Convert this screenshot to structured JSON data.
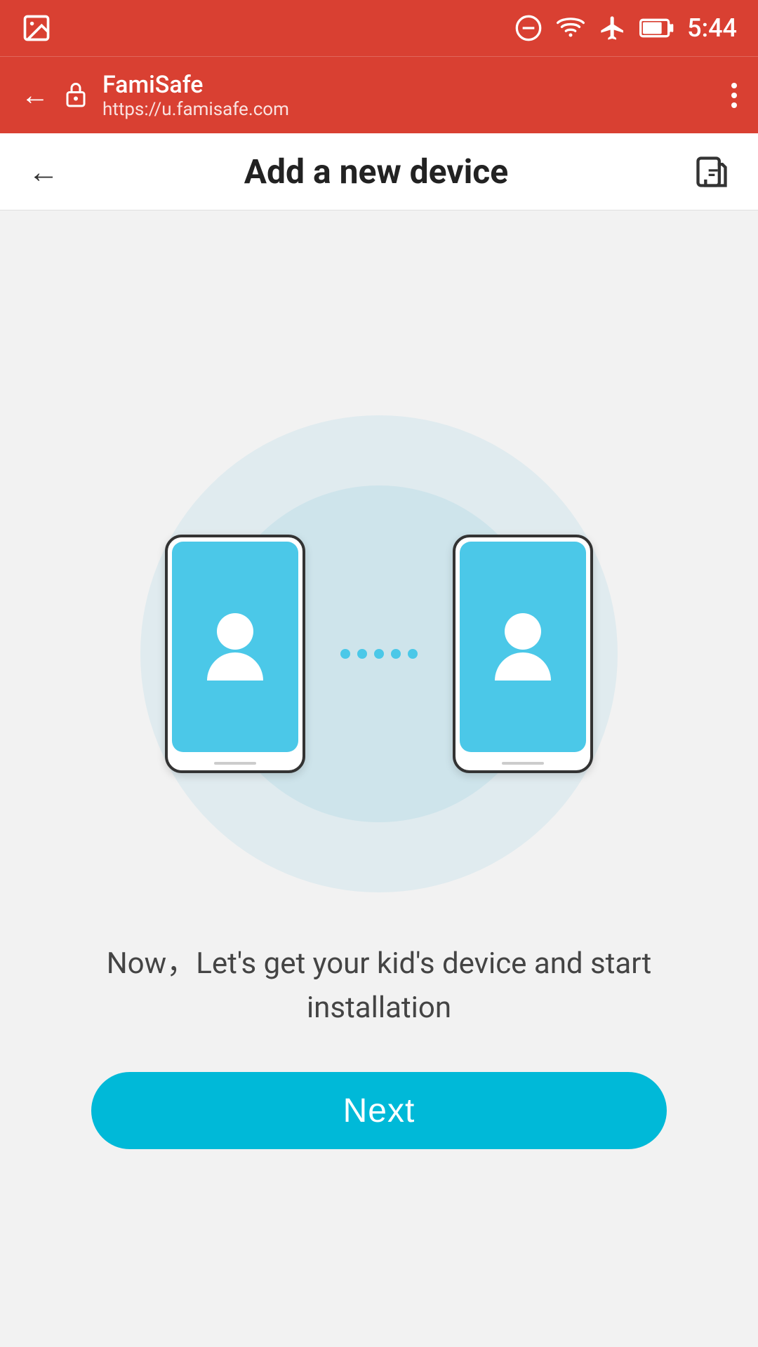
{
  "statusBar": {
    "time": "5:44",
    "icons": {
      "doNotDisturb": "⊖",
      "wifi": "wifi",
      "airplane": "✈",
      "battery": "battery"
    }
  },
  "browserBar": {
    "appName": "FamiSafe",
    "url": "https://u.famisafe.com"
  },
  "pageHeader": {
    "title": "Add a new device"
  },
  "illustration": {
    "connectionDots": 5
  },
  "description": {
    "text": "Now，Let's get your kid's device and start installation"
  },
  "nextButton": {
    "label": "Next"
  },
  "colors": {
    "headerRed": "#d94032",
    "skyBlue": "#4bc8e8",
    "buttonBlue": "#00b9d8"
  }
}
